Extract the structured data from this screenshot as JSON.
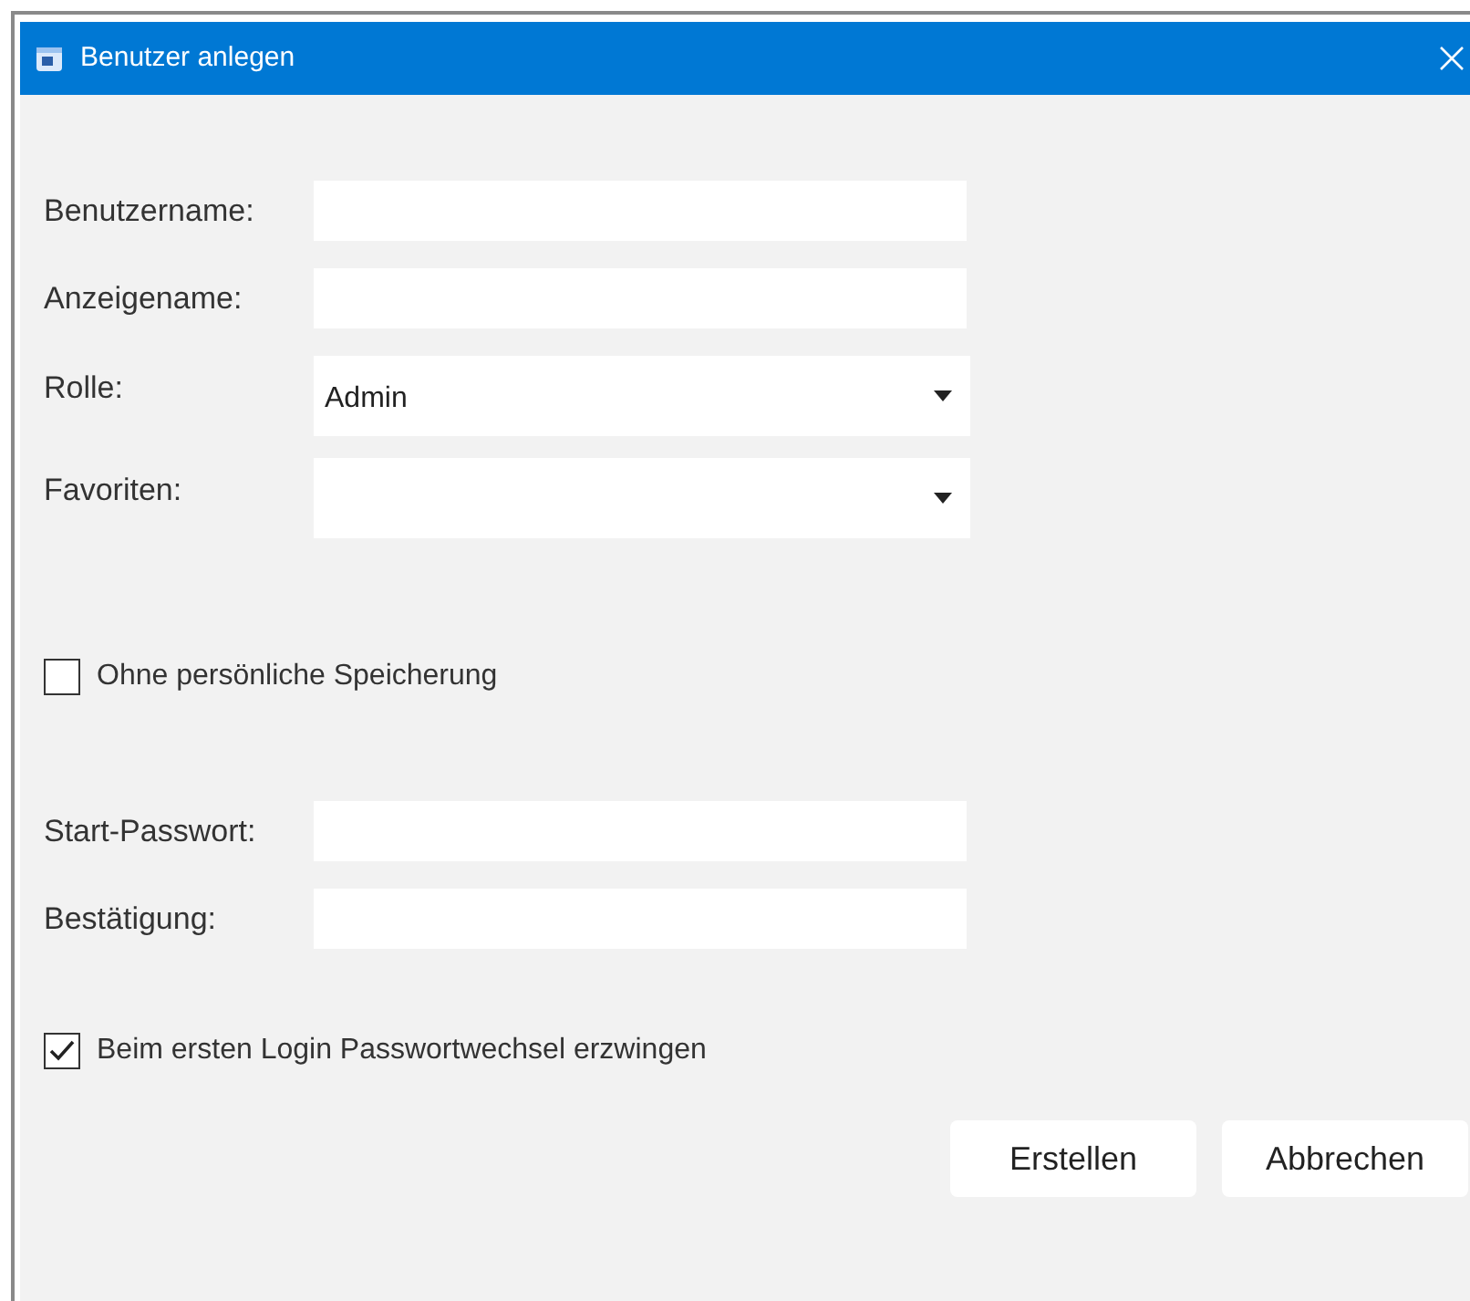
{
  "window": {
    "title": "Benutzer anlegen"
  },
  "fields_top": [
    {
      "kind": "text",
      "label": "Benutzername:"
    },
    {
      "kind": "text",
      "label": "Anzeigename:"
    },
    {
      "kind": "dropdown",
      "label": "Rolle:",
      "value": "Admin"
    },
    {
      "kind": "dropdown",
      "label": "Favoriten:"
    }
  ],
  "storage_checkbox": {
    "label": "Ohne persönliche Speicherung",
    "checked": false
  },
  "fields_password": [
    {
      "kind": "text",
      "label": "Start-Passwort:"
    },
    {
      "kind": "text",
      "label": "Bestätigung:"
    }
  ],
  "force_change_checkbox": {
    "label": "Beim ersten Login Passwortwechsel erzwingen",
    "checked": true
  },
  "buttons": [
    "Erstellen",
    "Abbrechen"
  ]
}
